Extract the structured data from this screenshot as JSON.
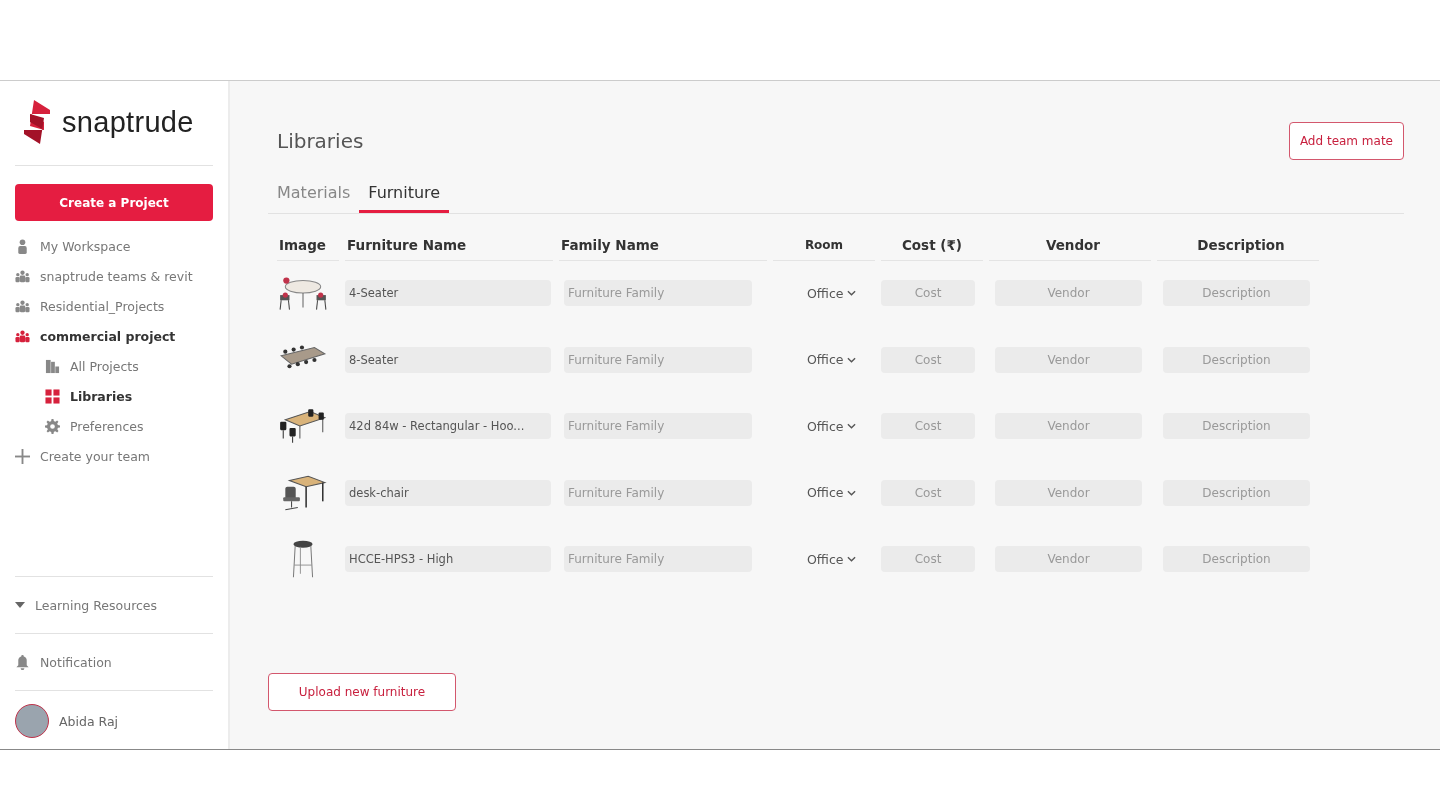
{
  "brand": {
    "name": "snaptrude"
  },
  "sidebar": {
    "create_button": "Create a Project",
    "items": [
      {
        "label": "My Workspace",
        "kind": "person",
        "selected": false
      },
      {
        "label": "snaptrude teams & revit",
        "kind": "team",
        "selected": false
      },
      {
        "label": "Residential_Projects",
        "kind": "team",
        "selected": false
      },
      {
        "label": "commercial project",
        "kind": "team",
        "selected": true,
        "children": [
          {
            "label": "All Projects",
            "kind": "building",
            "selected": false
          },
          {
            "label": "Libraries",
            "kind": "grid",
            "selected": true
          },
          {
            "label": "Preferences",
            "kind": "gear",
            "selected": false
          }
        ]
      },
      {
        "label": "Create your team",
        "kind": "plus",
        "selected": false
      }
    ],
    "learning": {
      "label": "Learning Resources",
      "expanded": false
    },
    "notification": "Notification",
    "user": {
      "name": "Abida Raj"
    }
  },
  "page": {
    "title": "Libraries",
    "add_button": "Add team mate",
    "tabs": [
      {
        "label": "Materials",
        "selected": false
      },
      {
        "label": "Furniture",
        "selected": true
      }
    ]
  },
  "table": {
    "columns": [
      "Image",
      "Furniture Name",
      "Family Name",
      "Room",
      "Cost (₹)",
      "Vendor",
      "Description"
    ],
    "rows": [
      {
        "kind": "round-table",
        "name": "4-Seater",
        "family_placeholder": "Furniture Family",
        "room": "Office",
        "cost_placeholder": "Cost",
        "vendor_placeholder": "Vendor",
        "description_placeholder": "Description"
      },
      {
        "kind": "long-table",
        "name": "8-Seater",
        "family_placeholder": "Furniture Family",
        "room": "Office",
        "cost_placeholder": "Cost",
        "vendor_placeholder": "Vendor",
        "description_placeholder": "Description"
      },
      {
        "kind": "rect-table",
        "name": "42d 84w - Rectangular - Hoo...",
        "family_placeholder": "Furniture Family",
        "room": "Office",
        "cost_placeholder": "Cost",
        "vendor_placeholder": "Vendor",
        "description_placeholder": "Description"
      },
      {
        "kind": "desk",
        "name": "desk-chair",
        "family_placeholder": "Furniture Family",
        "room": "Office",
        "cost_placeholder": "Cost",
        "vendor_placeholder": "Vendor",
        "description_placeholder": "Description"
      },
      {
        "kind": "stool",
        "name": "HCCE-HPS3 - High",
        "family_placeholder": "Furniture Family",
        "room": "Office",
        "cost_placeholder": "Cost",
        "vendor_placeholder": "Vendor",
        "description_placeholder": "Description"
      }
    ]
  },
  "upload_button": "Upload new furniture"
}
